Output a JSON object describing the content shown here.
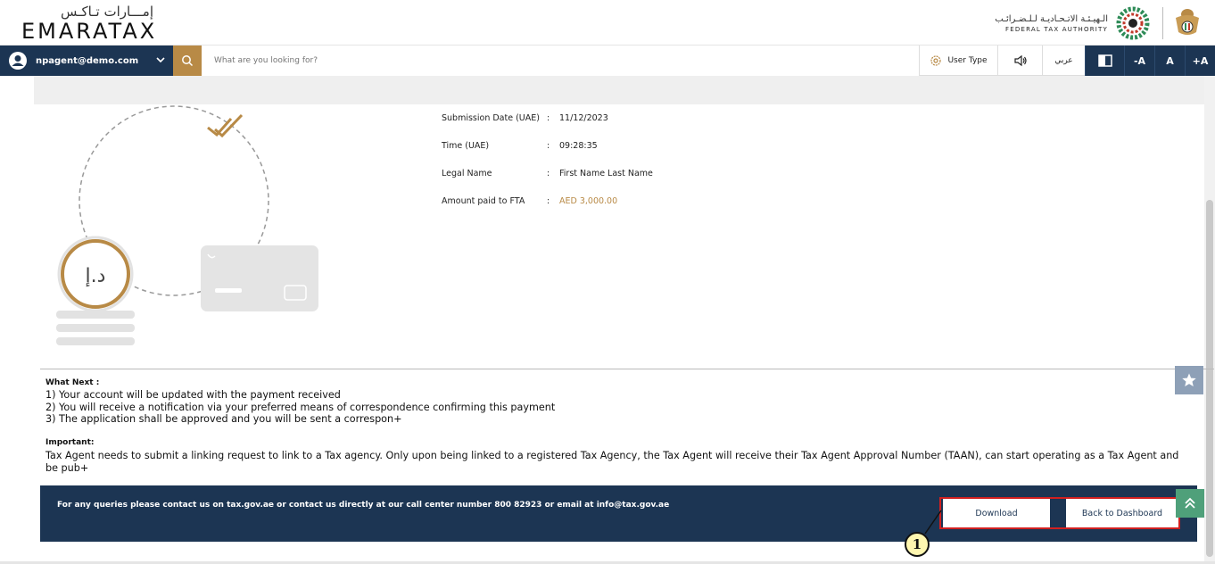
{
  "header": {
    "logo_arabic": "إمـــارات تـاكـس",
    "logo_english": "EMARATAX",
    "fta_arabic": "الـهيـئـة الاتـحـاديـة لـلـضـرائـب",
    "fta_english": "FEDERAL TAX AUTHORITY"
  },
  "nav": {
    "user_email": "npagent@demo.com",
    "search_placeholder": "What are you looking for?",
    "user_type_label": "User Type",
    "arabic_label": "عربي",
    "font_decrease": "-A",
    "font_normal": "A",
    "font_increase": "+A"
  },
  "details": {
    "rows": [
      {
        "label": "Submission Date (UAE)",
        "value": "11/12/2023"
      },
      {
        "label": "Time (UAE)",
        "value": "09:28:35"
      },
      {
        "label": "Legal Name",
        "value": "First Name Last Name"
      },
      {
        "label": "Amount paid to FTA",
        "value": "AED 3,000.00"
      }
    ],
    "colon": ":"
  },
  "illustration": {
    "coin_text": "د.إ"
  },
  "what_next": {
    "heading": "What Next :",
    "items": [
      "1) Your account will be updated with the payment received",
      "2) You will receive a notification via your preferred means of correspondence confirming this payment",
      "3) The application shall be approved and you will be sent a correspon+"
    ]
  },
  "important": {
    "heading": "Important:",
    "text": "Tax Agent needs to submit a linking request to link to a Tax agency. Only upon being linked to a registered Tax Agency, the Tax Agent will receive their Tax Agent Approval Number (TAAN), can start operating as a Tax Agent and be pub+"
  },
  "footer": {
    "text": "For any queries please contact us on tax.gov.ae or contact us directly at our call center number 800 82923 or email at info@tax.gov.ae",
    "download_label": "Download",
    "dashboard_label": "Back to Dashboard"
  },
  "callout": {
    "number": "1"
  },
  "colors": {
    "navy": "#1c3553",
    "gold": "#b88a46",
    "highlight_red": "#d12020"
  }
}
